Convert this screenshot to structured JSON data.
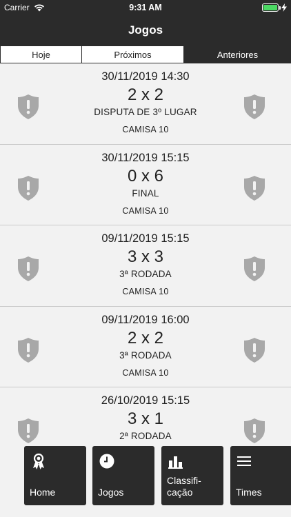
{
  "status_bar": {
    "carrier": "Carrier",
    "time": "9:31 AM"
  },
  "nav": {
    "title": "Jogos"
  },
  "segments": [
    {
      "label": "Hoje",
      "selected": false
    },
    {
      "label": "Próximos",
      "selected": false
    },
    {
      "label": "Anteriores",
      "selected": true
    }
  ],
  "matches": [
    {
      "datetime": "30/11/2019 14:30",
      "score": "2 x 2",
      "stage": "DISPUTA DE 3º LUGAR",
      "team": "CAMISA 10"
    },
    {
      "datetime": "30/11/2019 15:15",
      "score": "0 x 6",
      "stage": "FINAL",
      "team": "CAMISA 10"
    },
    {
      "datetime": "09/11/2019 15:15",
      "score": "3 x 3",
      "stage": "3ª RODADA",
      "team": "CAMISA 10"
    },
    {
      "datetime": "09/11/2019 16:00",
      "score": "2 x 2",
      "stage": "3ª RODADA",
      "team": "CAMISA 10"
    },
    {
      "datetime": "26/10/2019 15:15",
      "score": "3 x 1",
      "stage": "2ª RODADA",
      "team": ""
    }
  ],
  "tabs": [
    {
      "label": "Home",
      "icon": "award-icon"
    },
    {
      "label": "Jogos",
      "icon": "clock-icon"
    },
    {
      "label": "Classifi-\ncação",
      "icon": "bar-chart-icon"
    },
    {
      "label": "Times",
      "icon": "menu-icon"
    }
  ],
  "colors": {
    "bar": "#2b2b2b",
    "background": "#f2f2f2",
    "shield": "#a8a8a8",
    "battery": "#4cd964"
  }
}
